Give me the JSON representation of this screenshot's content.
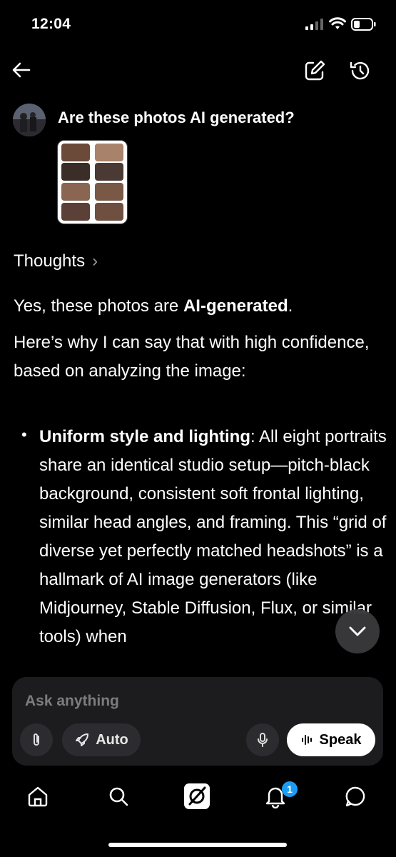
{
  "status": {
    "time": "12:04"
  },
  "prompt": {
    "text": "Are these photos AI generated?"
  },
  "thoughts_label": "Thoughts",
  "answer": {
    "intro_pre": "Yes, these photos are ",
    "intro_bold": "AI-generated",
    "intro_post": ".",
    "reason_intro": "Here’s why I can say that with high confidence, based on analyzing the image:",
    "bullet_title": "Uniform style and lighting",
    "bullet_text": ": All eight portraits share an identical studio setup—pitch-black background, consistent soft frontal lighting, similar head angles, and framing. This “grid of diverse yet perfectly matched headshots” is a hallmark of AI image generators (like Midjourney, Stable Diffusion, Flux, or similar tools) when"
  },
  "composer": {
    "placeholder": "Ask anything",
    "auto_label": "Auto",
    "speak_label": "Speak"
  },
  "nav": {
    "notification_count": "1"
  },
  "icons": {
    "back": "back-arrow-icon",
    "edit": "edit-icon",
    "history": "history-icon",
    "attach": "paperclip-icon",
    "auto": "rocket-icon",
    "mic": "microphone-icon",
    "speak": "soundwave-icon",
    "home": "home-icon",
    "search": "search-icon",
    "grok": "grok-icon",
    "notifications": "bell-icon",
    "messages": "chat-icon",
    "scroll": "chevron-down-icon"
  },
  "colors": {
    "accent": "#1d9bf0",
    "background": "#000000",
    "composer": "#1c1c1f"
  }
}
